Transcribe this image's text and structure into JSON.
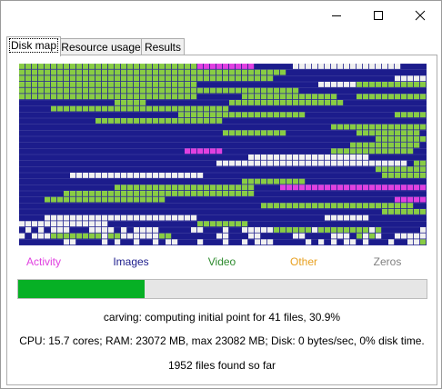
{
  "window": {
    "controls": {
      "minimize": "minimize-icon",
      "maximize": "maximize-icon",
      "close": "close-icon"
    }
  },
  "tabs": [
    {
      "label": "Disk map",
      "active": true
    },
    {
      "label": "Resource usage",
      "active": false
    },
    {
      "label": "Results",
      "active": false
    }
  ],
  "disk_map": {
    "grid_cols": 64,
    "grid_rows": 30,
    "colors": {
      "background": "#1c1c8c",
      "activity": "#e040e0",
      "images": "#1c1c8c",
      "video": "#88cc44",
      "zeros": "#f0f0f0",
      "other": "#f0a030"
    }
  },
  "legend": [
    {
      "label": "Activity",
      "color": "#e040e0"
    },
    {
      "label": "Images",
      "color": "#1c1c8c"
    },
    {
      "label": "Video",
      "color": "#2e8b2e"
    },
    {
      "label": "Other",
      "color": "#e8a020"
    },
    {
      "label": "Zeros",
      "color": "#808080"
    }
  ],
  "progress": {
    "fraction": 0.309,
    "color": "#06b025"
  },
  "status": {
    "carving": "carving: computing initial point for 41 files, 30.9%",
    "resources": "CPU: 15.7 cores; RAM: 23072 MB, max 23082 MB; Disk: 0 bytes/sec, 0% disk time.",
    "found": "1952 files found so far"
  }
}
